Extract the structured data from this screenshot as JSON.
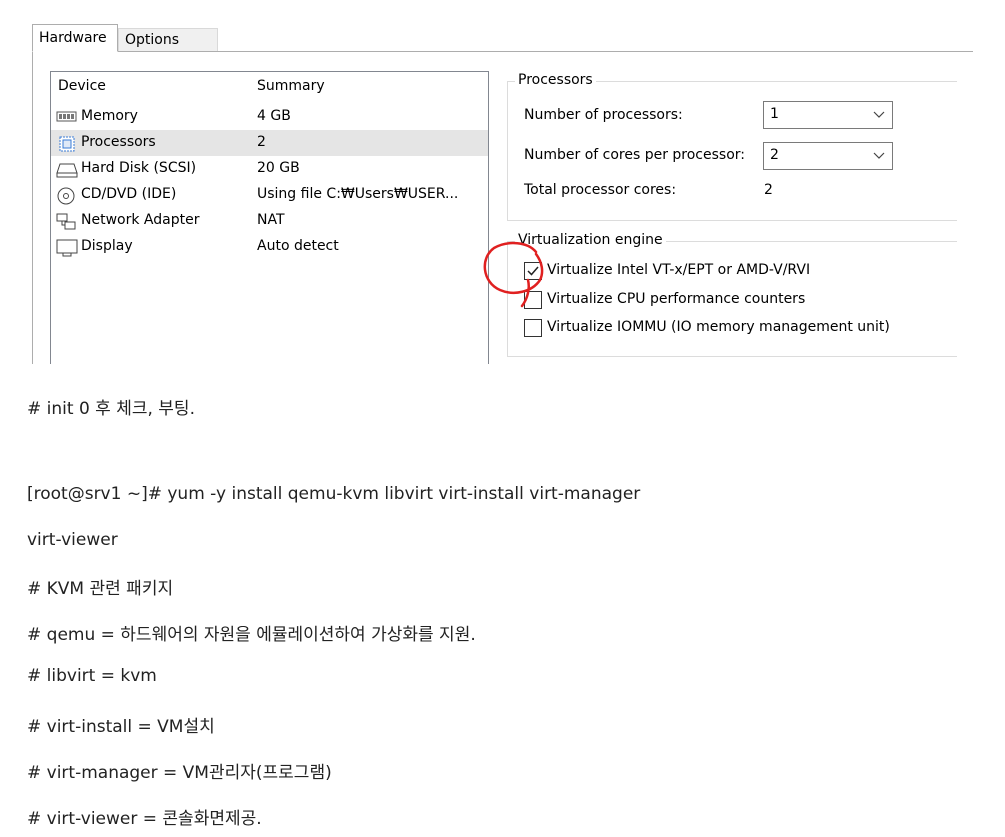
{
  "tabs": [
    "Hardware",
    "Options"
  ],
  "device_list": {
    "headers": {
      "device": "Device",
      "summary": "Summary"
    },
    "rows": [
      {
        "icon": "memory-icon",
        "device": "Memory",
        "summary": "4 GB"
      },
      {
        "icon": "processor-icon",
        "device": "Processors",
        "summary": "2"
      },
      {
        "icon": "hard-disk-icon",
        "device": "Hard Disk (SCSI)",
        "summary": "20 GB"
      },
      {
        "icon": "cd-dvd-icon",
        "device": "CD/DVD (IDE)",
        "summary": "Using file C:₩Users₩USER..."
      },
      {
        "icon": "network-adapter-icon",
        "device": "Network Adapter",
        "summary": "NAT"
      },
      {
        "icon": "display-icon",
        "device": "Display",
        "summary": "Auto detect"
      }
    ],
    "selected_index": 1
  },
  "processors": {
    "title": "Processors",
    "num_processors_label": "Number of processors:",
    "num_processors_value": "1",
    "cores_label": "Number of cores per processor:",
    "cores_value": "2",
    "total_label": "Total processor cores:",
    "total_value": "2"
  },
  "virtualization": {
    "title": "Virtualization engine",
    "options": [
      {
        "label": "Virtualize Intel VT-x/EPT or AMD-V/RVI",
        "checked": true
      },
      {
        "label": "Virtualize CPU performance counters",
        "checked": false
      },
      {
        "label": "Virtualize IOMMU (IO memory management unit)",
        "checked": false
      }
    ],
    "annotation_color": "#e02020"
  },
  "blog": {
    "lines": [
      "# init 0 후 체크, 부팅.",
      "[root@srv1 ~]# yum -y install qemu-kvm libvirt virt-install virt-manager",
      "virt-viewer",
      "# KVM 관련 패키지",
      "# qemu = 하드웨어의 자원을 에뮬레이션하여 가상화를 지원.",
      "# libvirt = kvm",
      "# virt-install = VM설치",
      "# virt-manager = VM관리자(프로그램)",
      "# virt-viewer = 콘솔화면제공."
    ]
  }
}
